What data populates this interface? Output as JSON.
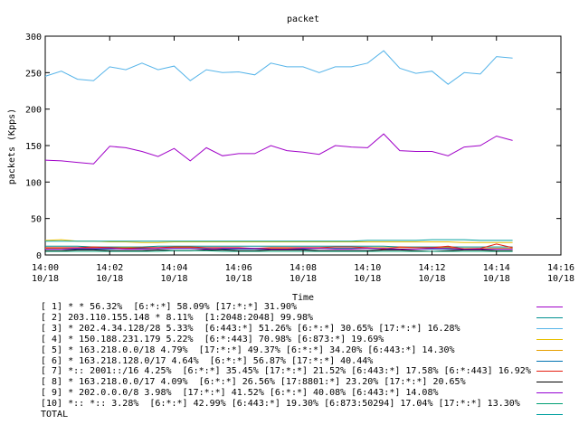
{
  "chart_data": {
    "type": "line",
    "title": "packet",
    "xlabel": "Time",
    "ylabel": "packets (Kpps)",
    "ylim": [
      0,
      300
    ],
    "yticks": [
      "0",
      "50",
      "100",
      "150",
      "200",
      "250",
      "300"
    ],
    "xlim": [
      "14:00",
      "14:16"
    ],
    "xticks": [
      {
        "time": "14:00",
        "date": "10/18"
      },
      {
        "time": "14:02",
        "date": "10/18"
      },
      {
        "time": "14:04",
        "date": "10/18"
      },
      {
        "time": "14:06",
        "date": "10/18"
      },
      {
        "time": "14:08",
        "date": "10/18"
      },
      {
        "time": "14:10",
        "date": "10/18"
      },
      {
        "time": "14:12",
        "date": "10/18"
      },
      {
        "time": "14:14",
        "date": "10/18"
      },
      {
        "time": "14:16",
        "date": "10/18"
      }
    ],
    "x": [
      "14:00:00",
      "14:00:30",
      "14:01:00",
      "14:01:30",
      "14:02:00",
      "14:02:30",
      "14:03:00",
      "14:03:30",
      "14:04:00",
      "14:04:30",
      "14:05:00",
      "14:05:30",
      "14:06:00",
      "14:06:30",
      "14:07:00",
      "14:07:30",
      "14:08:00",
      "14:08:30",
      "14:09:00",
      "14:09:30",
      "14:10:00",
      "14:10:30",
      "14:11:00",
      "14:11:30",
      "14:12:00",
      "14:12:30",
      "14:13:00",
      "14:13:30",
      "14:14:00",
      "14:14:30"
    ],
    "series": [
      {
        "name": "[ 1] * * 56.32%  [6:*:*] 58.09% [17:*:*] 31.90%",
        "color": "#a000c8",
        "values": [
          130,
          129,
          127,
          125,
          149,
          147,
          142,
          135,
          146,
          129,
          147,
          136,
          139,
          139,
          150,
          143,
          141,
          138,
          150,
          148,
          147,
          166,
          143,
          142,
          142,
          136,
          148,
          150,
          163,
          157
        ]
      },
      {
        "name": "[ 2] 203.110.155.148 * 8.11%  [1:2048:2048] 99.98%",
        "color": "#009090",
        "values": [
          12,
          12,
          12,
          11,
          11,
          11,
          11,
          12,
          12,
          12,
          12,
          12,
          12,
          12,
          12,
          12,
          12,
          12,
          12,
          12,
          12,
          12,
          11,
          11,
          11,
          11,
          11,
          11,
          11,
          11
        ]
      },
      {
        "name": "[ 3] * 202.4.34.128/28 5.33%  [6:443:*] 51.26% [6:*:*] 30.65% [17:*:*] 16.28%",
        "color": "#56b4e9",
        "values": [
          245,
          252,
          241,
          239,
          258,
          254,
          263,
          254,
          259,
          239,
          254,
          250,
          251,
          247,
          263,
          258,
          258,
          250,
          258,
          258,
          263,
          280,
          256,
          249,
          252,
          234,
          250,
          248,
          272,
          270
        ]
      },
      {
        "name": "[ 4] * 150.188.231.179 5.22%  [6:*:443] 70.98% [6:873:*] 19.69%",
        "color": "#e8c000",
        "values": [
          20,
          21,
          19,
          19,
          18,
          18,
          17,
          17,
          18,
          18,
          18,
          18,
          18,
          18,
          18,
          18,
          18,
          18,
          18,
          18,
          18,
          18,
          18,
          18,
          18,
          18,
          17,
          17,
          17,
          17
        ]
      },
      {
        "name": "[ 5] * 163.218.0.0/18 4.79%  [17:*:*] 49.37% [6:*:*] 34.20% [6:443:*] 14.30%",
        "color": "#e69f00",
        "values": [
          9,
          9,
          9,
          10,
          10,
          10,
          10,
          10,
          10,
          10,
          9,
          9,
          9,
          9,
          9,
          9,
          9,
          9,
          9,
          9,
          10,
          10,
          10,
          10,
          10,
          10,
          9,
          9,
          9,
          9
        ]
      },
      {
        "name": "[ 6] * 163.218.128.0/17 4.64%  [6:*:*] 56.87% [17:*:*] 40.44%",
        "color": "#0072b2",
        "values": [
          8,
          8,
          8,
          8,
          8,
          9,
          9,
          9,
          9,
          9,
          9,
          8,
          8,
          8,
          8,
          8,
          8,
          9,
          9,
          9,
          9,
          8,
          8,
          8,
          8,
          8,
          8,
          8,
          8,
          8
        ]
      },
      {
        "name": "[ 7] *:: 2001::/16 4.25%  [6:*:*] 35.45% [17:*:*] 21.52% [6:443:*] 17.58% [6:*:443] 16.92%",
        "color": "#e51e10",
        "values": [
          10,
          10,
          10,
          11,
          10,
          9,
          10,
          10,
          11,
          11,
          10,
          10,
          10,
          9,
          10,
          10,
          10,
          10,
          11,
          11,
          10,
          8,
          11,
          10,
          10,
          12,
          8,
          9,
          15,
          10
        ]
      },
      {
        "name": "[ 8] * 163.218.0.0/17 4.09%  [6:*:*] 26.56% [17:8801:*] 23.20% [17:*:*] 20.65%",
        "color": "#000000",
        "values": [
          6,
          6,
          7,
          7,
          6,
          6,
          6,
          7,
          6,
          6,
          7,
          7,
          6,
          6,
          7,
          7,
          7,
          6,
          6,
          6,
          6,
          7,
          7,
          6,
          5,
          6,
          7,
          7,
          6,
          6
        ]
      },
      {
        "name": "[ 9] * 202.0.0.0/8 3.98%  [17:*:*] 41.52% [6:*:*] 40.08% [6:443:*] 14.08%",
        "color": "#9400d3",
        "values": [
          8,
          8,
          9,
          9,
          9,
          8,
          8,
          9,
          9,
          9,
          8,
          9,
          9,
          9,
          8,
          8,
          9,
          9,
          8,
          8,
          9,
          9,
          8,
          8,
          9,
          9,
          8,
          8,
          8,
          8
        ]
      },
      {
        "name": "[10] *:: *:: 3.28%  [6:*:*] 42.99% [6:443:*] 19.30% [6:873:50294] 17.04% [17:*:*] 13.30%",
        "color": "#009e73",
        "values": [
          5,
          5,
          5,
          5,
          5,
          5,
          5,
          5,
          6,
          6,
          6,
          5,
          5,
          5,
          5,
          5,
          5,
          5,
          5,
          5,
          5,
          5,
          5,
          5,
          5,
          5,
          5,
          5,
          5,
          5
        ]
      },
      {
        "name": "TOTAL",
        "color": "#00a0a0",
        "values": [
          19,
          19,
          19,
          19,
          19,
          19,
          19,
          19,
          19,
          19,
          19,
          19,
          19,
          19,
          19,
          19,
          19,
          19,
          19,
          19,
          20,
          20,
          20,
          20,
          21,
          21,
          21,
          20,
          20,
          20
        ]
      }
    ]
  }
}
